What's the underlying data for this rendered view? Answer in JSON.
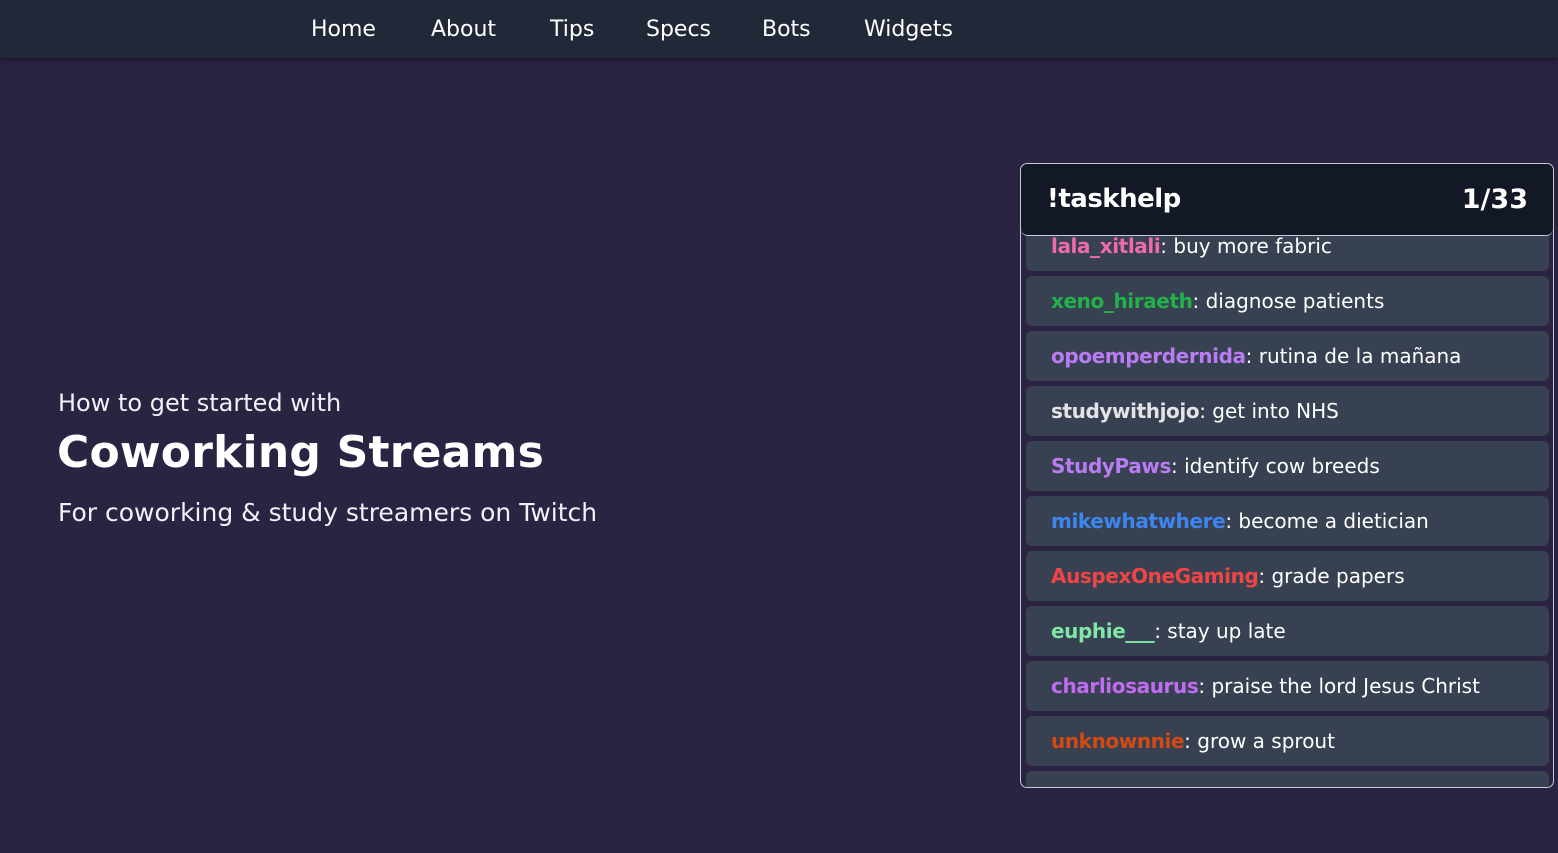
{
  "nav": {
    "items": [
      {
        "label": "Home"
      },
      {
        "label": "About"
      },
      {
        "label": "Tips"
      },
      {
        "label": "Specs"
      },
      {
        "label": "Bots"
      },
      {
        "label": "Widgets"
      }
    ]
  },
  "hero": {
    "pre_title": "How to get started with",
    "title": "Coworking Streams",
    "subtitle": "For coworking & study streamers on Twitch"
  },
  "widget": {
    "title": "!taskhelp",
    "counter": "1/33",
    "separator": ": ",
    "tasks": [
      {
        "user": "lala_xitlali",
        "task": "buy more fabric",
        "color": "#f06ba8"
      },
      {
        "user": "xeno_hiraeth",
        "task": "diagnose patients",
        "color": "#22b24a"
      },
      {
        "user": "opoemperdernida",
        "task": "rutina de la mañana",
        "color": "#b97cf2"
      },
      {
        "user": "studywithjojo",
        "task": "get into NHS",
        "color": "#e3e3e8"
      },
      {
        "user": "StudyPaws",
        "task": "identify cow breeds",
        "color": "#b97cf2"
      },
      {
        "user": "mikewhatwhere",
        "task": "become a dietician",
        "color": "#3d86f0"
      },
      {
        "user": "AuspexOneGaming",
        "task": "grade papers",
        "color": "#f04545"
      },
      {
        "user": "euphie___",
        "task": "stay up late",
        "color": "#7fe6a6"
      },
      {
        "user": "charliosaurus",
        "task": "praise the lord Jesus Christ",
        "color": "#c06cf0"
      },
      {
        "user": "unknownnie",
        "task": "grow a sprout",
        "color": "#d44a12"
      }
    ]
  },
  "colors": {
    "page_background": "#2a2342",
    "navbar_background": "#212838",
    "widget_header_background": "#131826",
    "task_row_background": "#384151"
  }
}
